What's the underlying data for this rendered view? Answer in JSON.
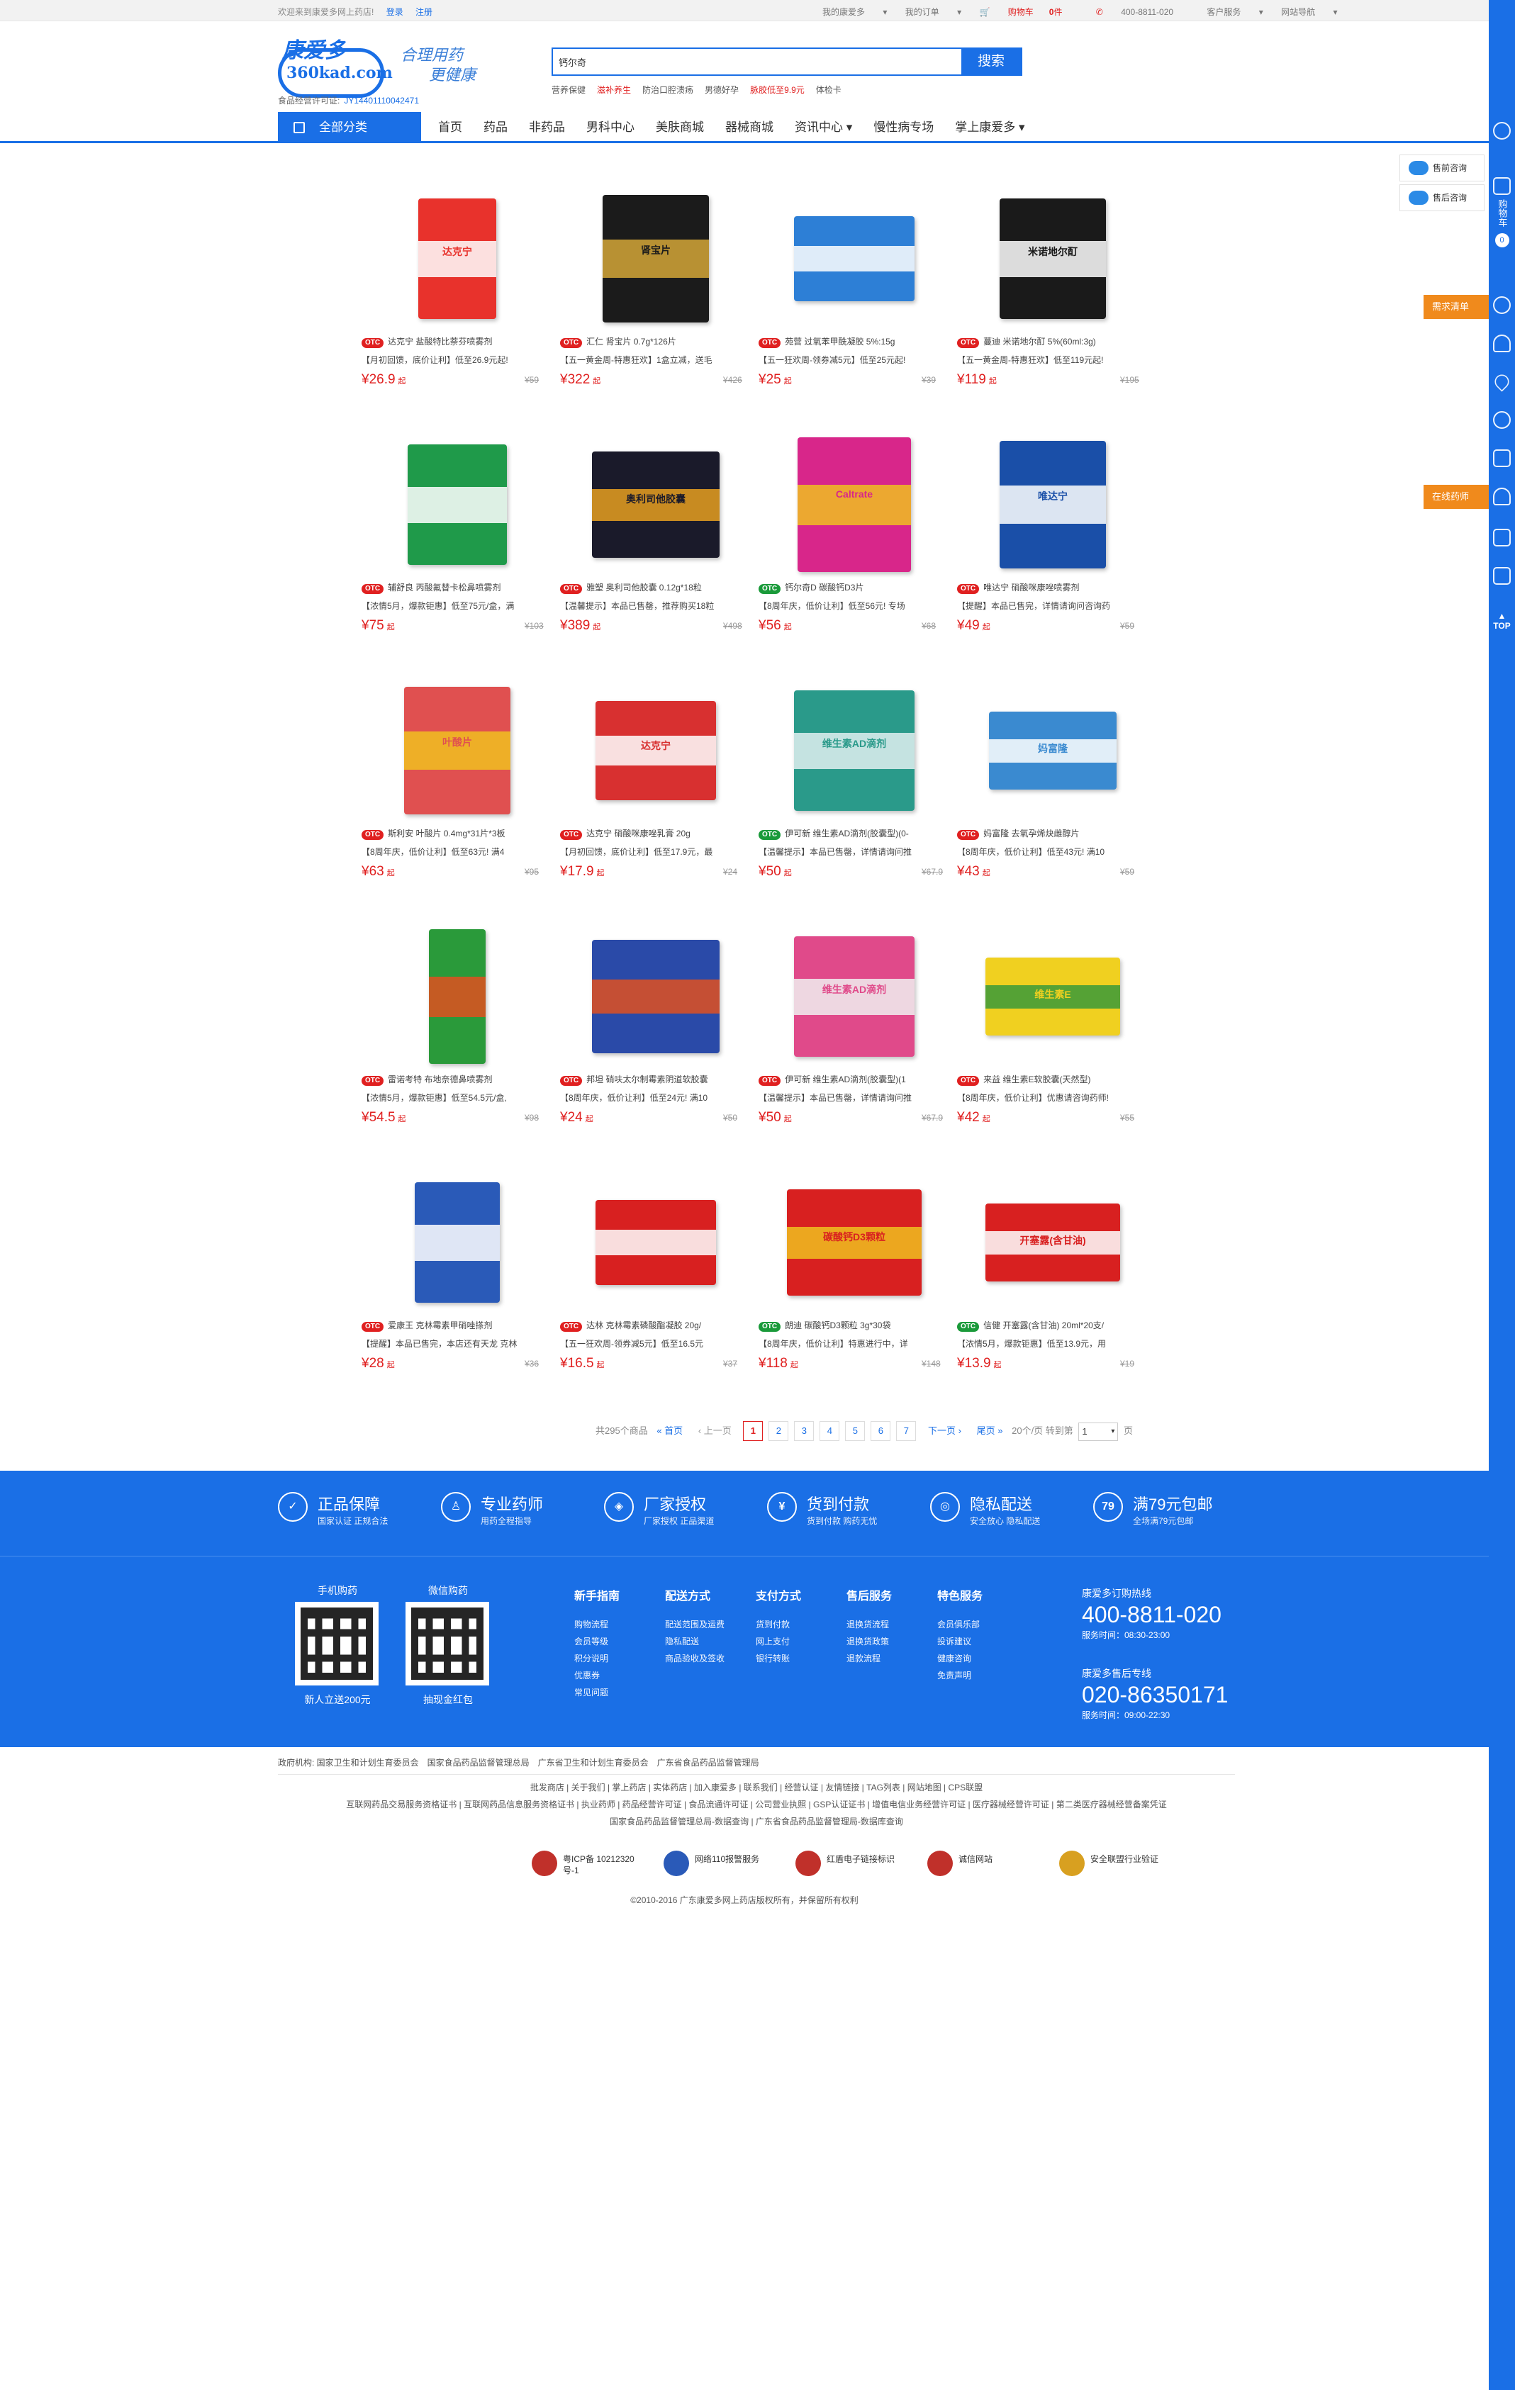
{
  "topbar": {
    "welcome": "欢迎来到康爱多网上药店!",
    "login": "登录",
    "register": "注册",
    "my_kad": "我的康爱多",
    "my_orders": "我的订单",
    "cart_prefix": "购物车",
    "cart_count": "0",
    "cart_suffix": "件",
    "hotline": "400-8811-020",
    "customer_service": "客户服务",
    "site_nav": "网站导航"
  },
  "header": {
    "logo_cn": "康爱多",
    "logo_en": "360kad.com",
    "slogan_1": "合理用药",
    "slogan_2": "更健康",
    "license_label": "食品经营许可证:",
    "license_no": "JY14401110042471",
    "search_value": "钙尔奇",
    "search_button": "搜索",
    "hotwords": [
      "营养保健",
      "滋补养生",
      "防治口腔溃疡",
      "男德好孕",
      "脉胶低至9.9元",
      "体检卡"
    ]
  },
  "nav": {
    "all_categories": "全部分类",
    "items": [
      "首页",
      "药品",
      "非药品",
      "男科中心",
      "美肤商城",
      "器械商城",
      "资讯中心 ▾",
      "慢性病专场",
      "掌上康爱多 ▾"
    ]
  },
  "products": [
    {
      "otc": "red",
      "title": "达克宁 盐酸特比萘芬喷雾剂",
      "promo": "【月初回馈，底价让利】低至26.9元起!",
      "price": "¥26.9",
      "old": "¥59"
    },
    {
      "otc": "red",
      "title": "汇仁 肾宝片 0.7g*126片",
      "promo": "【五一黄金周-特惠狂欢】1盒立减，送毛",
      "price": "¥322",
      "old": "¥426"
    },
    {
      "otc": "red",
      "title": "苑营 过氧苯甲酰凝胶 5%:15g",
      "promo": "【五一狂欢周-领券减5元】低至25元起!",
      "price": "¥25",
      "old": "¥39"
    },
    {
      "otc": "red",
      "title": "蔓迪 米诺地尔酊 5%(60ml:3g)",
      "promo": "【五一黄金周-特惠狂欢】低至119元起!",
      "price": "¥119",
      "old": "¥195"
    },
    {
      "otc": "red",
      "title": "辅舒良 丙酸氟替卡松鼻喷雾剂",
      "promo": "【浓情5月，爆款钜惠】低至75元/盒，满",
      "price": "¥75",
      "old": "¥103"
    },
    {
      "otc": "red",
      "title": "雅塑 奥利司他胶囊 0.12g*18粒",
      "promo": "【温馨提示】本品已售罄，推荐购买18粒",
      "price": "¥389",
      "old": "¥498"
    },
    {
      "otc": "green",
      "title": "钙尔奇D 碳酸钙D3片",
      "promo": "【8周年庆，低价让利】低至56元! 专场",
      "price": "¥56",
      "old": "¥68"
    },
    {
      "otc": "red",
      "title": "唯达宁 硝酸咪康唑喷雾剂",
      "promo": "【提醒】本品已售完，详情请询问咨询药",
      "price": "¥49",
      "old": "¥59"
    },
    {
      "otc": "red",
      "title": "斯利安 叶酸片 0.4mg*31片*3板",
      "promo": "【8周年庆，低价让利】低至63元! 满4",
      "price": "¥63",
      "old": "¥95"
    },
    {
      "otc": "red",
      "title": "达克宁 硝酸咪康唑乳膏 20g",
      "promo": "【月初回馈，底价让利】低至17.9元，最",
      "price": "¥17.9",
      "old": "¥24"
    },
    {
      "otc": "green",
      "title": "伊可新 维生素AD滴剂(胶囊型)(0-",
      "promo": "【温馨提示】本品已售罄，详情请询问推",
      "price": "¥50",
      "old": "¥67.9"
    },
    {
      "otc": "red",
      "title": "妈富隆 去氧孕烯炔雌醇片",
      "promo": "【8周年庆，低价让利】低至43元! 满10",
      "price": "¥43",
      "old": "¥59"
    },
    {
      "otc": "red",
      "title": "雷诺考特 布地奈德鼻喷雾剂",
      "promo": "【浓情5月，爆款钜惠】低至54.5元/盒,",
      "price": "¥54.5",
      "old": "¥98"
    },
    {
      "otc": "red",
      "title": "邦坦 硝呋太尔制霉素阴道软胶囊",
      "promo": "【8周年庆，低价让利】低至24元! 满10",
      "price": "¥24",
      "old": "¥50"
    },
    {
      "otc": "red",
      "title": "伊可新 维生素AD滴剂(胶囊型)(1",
      "promo": "【温馨提示】本品已售罄，详情请询问推",
      "price": "¥50",
      "old": "¥67.9"
    },
    {
      "otc": "red",
      "title": "来益 维生素E软胶囊(天然型)",
      "promo": "【8周年庆，低价让利】优惠请咨询药师!",
      "price": "¥42",
      "old": "¥55"
    },
    {
      "otc": "red",
      "title": "爱康王 克林霉素甲硝唑搽剂",
      "promo": "【提醒】本品已售完，本店还有天龙 克林",
      "price": "¥28",
      "old": "¥36"
    },
    {
      "otc": "red",
      "title": "达林 克林霉素磷酸酯凝胶 20g/",
      "promo": "【五一狂欢周-领券减5元】低至16.5元",
      "price": "¥16.5",
      "old": "¥37"
    },
    {
      "otc": "green",
      "title": "朗迪 碳酸钙D3颗粒 3g*30袋",
      "promo": "【8周年庆，低价让利】特惠进行中，详",
      "price": "¥118",
      "old": "¥148"
    },
    {
      "otc": "green",
      "title": "信健 开塞露(含甘油) 20ml*20支/",
      "promo": "【浓情5月，爆款钜惠】低至13.9元，用",
      "price": "¥13.9",
      "old": "¥19"
    }
  ],
  "product_images": [
    {
      "color": "#e8322c",
      "label": "达克宁",
      "accent": "#ffffff"
    },
    {
      "color": "#1b1b1b",
      "label": "肾宝片",
      "accent": "#d4a637"
    },
    {
      "color": "#2d7fd6",
      "label": "",
      "accent": "#ffffff"
    },
    {
      "color": "#1a1a1a",
      "label": "米诺地尔酊",
      "accent": "#ffffff"
    },
    {
      "color": "#1f9a4a",
      "label": "",
      "accent": "#ffffff"
    },
    {
      "color": "#1a1a2a",
      "label": "奥利司他胶囊",
      "accent": "#e8a020"
    },
    {
      "color": "#d8268a",
      "label": "Caltrate",
      "accent": "#f0c020"
    },
    {
      "color": "#1a4fa8",
      "label": "唯达宁",
      "accent": "#ffffff"
    },
    {
      "color": "#e05050",
      "label": "叶酸片",
      "accent": "#f0c020"
    },
    {
      "color": "#d83030",
      "label": "达克宁",
      "accent": "#ffffff"
    },
    {
      "color": "#2a9a8a",
      "label": "维生素AD滴剂",
      "accent": "#e0f0f0"
    },
    {
      "color": "#3a8ad0",
      "label": "妈富隆",
      "accent": "#ffffff"
    },
    {
      "color": "#2a9a3a",
      "label": "",
      "accent": "#e05020"
    },
    {
      "color": "#2a4aa8",
      "label": "",
      "accent": "#e05020"
    },
    {
      "color": "#e04a8a",
      "label": "维生素AD滴剂",
      "accent": "#f0f0f0"
    },
    {
      "color": "#f0d020",
      "label": "维生素E",
      "accent": "#3a9a3a"
    },
    {
      "color": "#2a5ab8",
      "label": "",
      "accent": "#ffffff"
    },
    {
      "color": "#d82020",
      "label": "",
      "accent": "#ffffff"
    },
    {
      "color": "#d82020",
      "label": "碳酸钙D3颗粒",
      "accent": "#f0c020"
    },
    {
      "color": "#d82020",
      "label": "开塞露(含甘油)",
      "accent": "#ffffff"
    }
  ],
  "pagination": {
    "total": "共295个商品",
    "first": "首页",
    "prev": "上一页",
    "pages": [
      "1",
      "2",
      "3",
      "4",
      "5",
      "6",
      "7"
    ],
    "next": "下一页",
    "last": "尾页",
    "per_page": "20个/页 转到第",
    "goto_value": "1",
    "page_unit": "页"
  },
  "service_band": [
    {
      "icon": "✓",
      "t1": "正品保障",
      "t2": "国家认证 正规合法"
    },
    {
      "icon": "♙",
      "t1": "专业药师",
      "t2": "用药全程指导"
    },
    {
      "icon": "◈",
      "t1": "厂家授权",
      "t2": "厂家授权 正品渠道"
    },
    {
      "icon": "¥",
      "t1": "货到付款",
      "t2": "货到付款 购药无忧"
    },
    {
      "icon": "◎",
      "t1": "隐私配送",
      "t2": "安全放心 隐私配送"
    },
    {
      "icon": "79",
      "t1": "满79元包邮",
      "t2": "全场满79元包邮"
    }
  ],
  "footer": {
    "qr1_label": "手机购药",
    "qr1_caption": "新人立送200元",
    "qr2_label": "微信购药",
    "qr2_caption": "抽现金红包",
    "columns": [
      {
        "h": "新手指南",
        "items": [
          "购物流程",
          "会员等级",
          "积分说明",
          "优惠券",
          "常见问题"
        ]
      },
      {
        "h": "配送方式",
        "items": [
          "配送范围及运费",
          "隐私配送",
          "商品验收及签收"
        ]
      },
      {
        "h": "支付方式",
        "items": [
          "货到付款",
          "网上支付",
          "银行转账"
        ]
      },
      {
        "h": "售后服务",
        "items": [
          "退换货流程",
          "退换货政策",
          "退款流程"
        ]
      },
      {
        "h": "特色服务",
        "items": [
          "会员俱乐部",
          "投诉建议",
          "健康咨询",
          "免责声明"
        ]
      }
    ],
    "order_hotline_label": "康爱多订购热线",
    "order_hotline": "400-8811-020",
    "order_hours": "服务时间：08:30-23:00",
    "aftersale_label": "康爱多售后专线",
    "aftersale_hotline": "020-86350171",
    "aftersale_hours": "服务时间：09:00-22:30"
  },
  "gov_links": "政府机构: 国家卫生和计划生育委员会　国家食品药品监督管理总局　广东省卫生和计划生育委员会　广东省食品药品监督管理局",
  "bottom_links_1": "批发商店 | 关于我们 | 掌上药店 | 实体药店 | 加入康爱多 | 联系我们 | 经营认证 | 友情链接 | TAG列表 | 网站地图 | CPS联盟",
  "bottom_links_2": "互联网药品交易服务资格证书 | 互联网药品信息服务资格证书 | 执业药师 | 药品经营许可证 | 食品流通许可证 | 公司营业执照 | GSP认证证书 | 增值电信业务经营许可证 | 医疗器械经营许可证 | 第二类医疗器械经营备案凭证",
  "bottom_links_3": "国家食品药品监督管理总局-数据查询 | 广东省食品药品监督管理局-数据库查询",
  "badges": [
    {
      "t": "粤ICP备 10212320号-1",
      "c": "#c0302a"
    },
    {
      "t": "网络110报警服务",
      "c": "#2a5ab8"
    },
    {
      "t": "红盾电子链接标识",
      "c": "#c0302a"
    },
    {
      "t": "诚信网站",
      "c": "#c0302a"
    },
    {
      "t": "安全联盟行业验证",
      "c": "#d8a020"
    }
  ],
  "copyright": "©2010-2016 广东康爱多网上药店版权所有，并保留所有权利",
  "sidebar": {
    "cart_label": "购物车",
    "cart_count": "0",
    "consult_before": "售前咨询",
    "consult_after": "售后咨询",
    "demand_list": "需求清单",
    "online_pharmacist": "在线药师",
    "top": "TOP"
  }
}
